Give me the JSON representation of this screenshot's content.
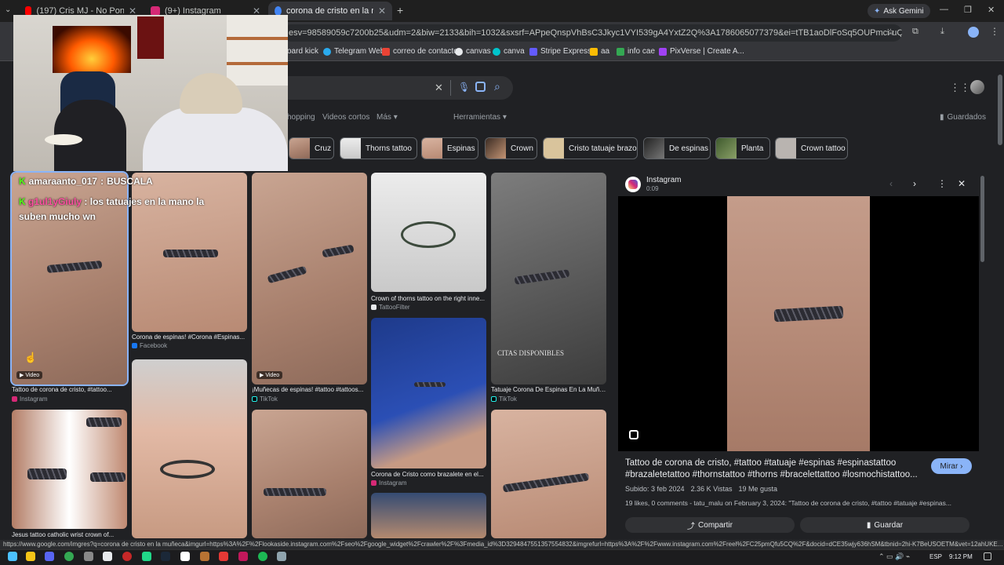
{
  "tabs": [
    {
      "label": "(197) Cris MJ - No Ponga Excus",
      "color": "#ff0000"
    },
    {
      "label": "(9+) Instagram",
      "color": "#d62976"
    },
    {
      "label": "corona de cristo en la muñeca",
      "color": "#4285f4"
    }
  ],
  "ask_gemini": "Ask Gemini",
  "url": "esv=98589059c7200b25&udm=2&biw=2133&bih=1032&sxsrf=APpeQnspVhBsC3Jkyc1VYI539gA4YxtZ2Q%3A1786065077379&ei=tTB1aoDlFoSq5OUPmci-uQ8&ved=0ahUKEwjA9u...",
  "bookmarks": [
    {
      "label": "oard kick",
      "color": "#53fc18"
    },
    {
      "label": "Telegram Web",
      "color": "#2aabee"
    },
    {
      "label": "correo de contacto",
      "color": "#ea4335"
    },
    {
      "label": "canvas",
      "color": "#e8eaed"
    },
    {
      "label": "canva",
      "color": "#00c4cc"
    },
    {
      "label": "Stripe Express",
      "color": "#635bff"
    },
    {
      "label": "aa",
      "color": "#fbbc04"
    },
    {
      "label": "info cae",
      "color": "#34a853"
    },
    {
      "label": "PixVerse | Create A...",
      "color": "#a142f4"
    }
  ],
  "nav": {
    "shopping": "hopping",
    "short_videos": "Videos cortos",
    "more": "Más",
    "tools": "Herramientas",
    "saved": "Guardados"
  },
  "chips": [
    "Cruz",
    "Thorns tattoo",
    "Espinas",
    "Crown",
    "Cristo tatuaje brazo",
    "De espinas",
    "Planta",
    "Crown tattoo"
  ],
  "chat": [
    {
      "user": "amaraanto_017",
      "msg": "BUSCALA",
      "user_color": "#ffffff"
    },
    {
      "user": "g1ul1yGiuly",
      "msg": "los tatuajes en la mano la suben mucho wn",
      "user_color": "#ff4fa3"
    }
  ],
  "results": [
    {
      "caption": "Tattoo de corona de cristo, #tattoo...",
      "source": "Instagram",
      "video": "Video"
    },
    {
      "caption": "Corona de espinas! #Corona #Espinas...",
      "source": "Facebook"
    },
    {
      "caption": "¡Muñecas de espinas! #tattoo #tattoos...",
      "source": "TikTok",
      "video": "Video"
    },
    {
      "caption": "Crown of thorns tattoo on the right inne...",
      "source": "TattooFilter"
    },
    {
      "caption": "Tatuaje Corona De Espinas En La Muñec...",
      "source": "TikTok"
    },
    {
      "caption": "Corona de Cristo como brazalete en el...",
      "source": "Instagram"
    },
    {
      "caption": "Jesus tattoo catholic wrist crown of...",
      "source": ""
    }
  ],
  "watermark": "CITAS DISPONIBLES",
  "panel": {
    "source": "Instagram",
    "duration": "0:09",
    "title": "Tattoo de corona de cristo, #tattoo #tatuaje #espinas #espinastattoo #brazaletetattoo #thornstattoo #thorns #bracelettattoo #losmochistattoo...",
    "visit": "Mirar",
    "uploaded": "Subido: 3 feb 2024",
    "views": "2.36 K Vistas",
    "likes": "19 Me gusta",
    "desc": "19 likes, 0 comments - tatu_malu on February 3, 2024: \"Tattoo de corona de cristo, #tattoo #tatuaje #espinas...",
    "share": "Compartir",
    "save": "Guardar"
  },
  "status_url": "https://www.google.com/imgres?q=corona de cristo en la muñeca&imgurl=https%3A%2F%2Flookaside.instagram.com%2Fseo%2Fgoogle_widget%2Fcrawler%2F%3Fmedia_id%3D3294847551357554832&imgrefurl=https%3A%2F%2Fwww.instagram.com%2Freel%2FC25pmQfu5CQ%2F&docid=dCE35wjy636hSM&tbnid=2hi-K7BeUSOETM&vet=12ahUKE...",
  "tray": {
    "lang": "ESP",
    "time": "9:12 PM"
  }
}
